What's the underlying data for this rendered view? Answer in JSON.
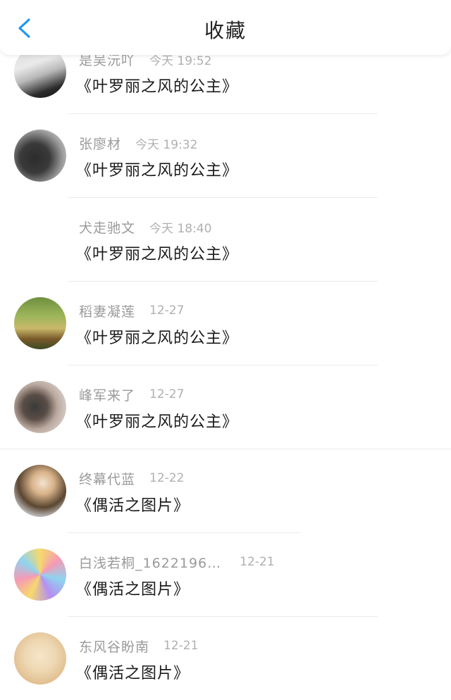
{
  "header": {
    "title": "收藏",
    "back_icon": "chevron-left-icon",
    "accent": "#2196f3"
  },
  "favorites": [
    {
      "name": "是吴沅吖",
      "time": "今天 19:52",
      "title": "《叶罗丽之风的公主》",
      "avatar": "photo-avatar"
    },
    {
      "name": "张廖材",
      "time": "今天 19:32",
      "title": "《叶罗丽之风的公主》",
      "avatar": "photo-avatar"
    },
    {
      "name": "犬走驰文",
      "time": "今天 18:40",
      "title": "《叶罗丽之风的公主》",
      "avatar": "blank-avatar"
    },
    {
      "name": "稻妻凝莲",
      "time": "12-27",
      "title": "《叶罗丽之风的公主》",
      "avatar": "photo-avatar"
    },
    {
      "name": "峰军来了",
      "time": "12-27",
      "title": "《叶罗丽之风的公主》",
      "avatar": "photo-avatar"
    },
    {
      "name": "终幕代蓝",
      "time": "12-22",
      "title": "《偶活之图片》",
      "avatar": "photo-avatar"
    },
    {
      "name": "白浅若桐_1622196…",
      "time": "12-21",
      "title": "《偶活之图片》",
      "avatar": "photo-avatar"
    },
    {
      "name": "东风谷盼南",
      "time": "12-21",
      "title": "《偶活之图片》",
      "avatar": "photo-avatar"
    }
  ]
}
